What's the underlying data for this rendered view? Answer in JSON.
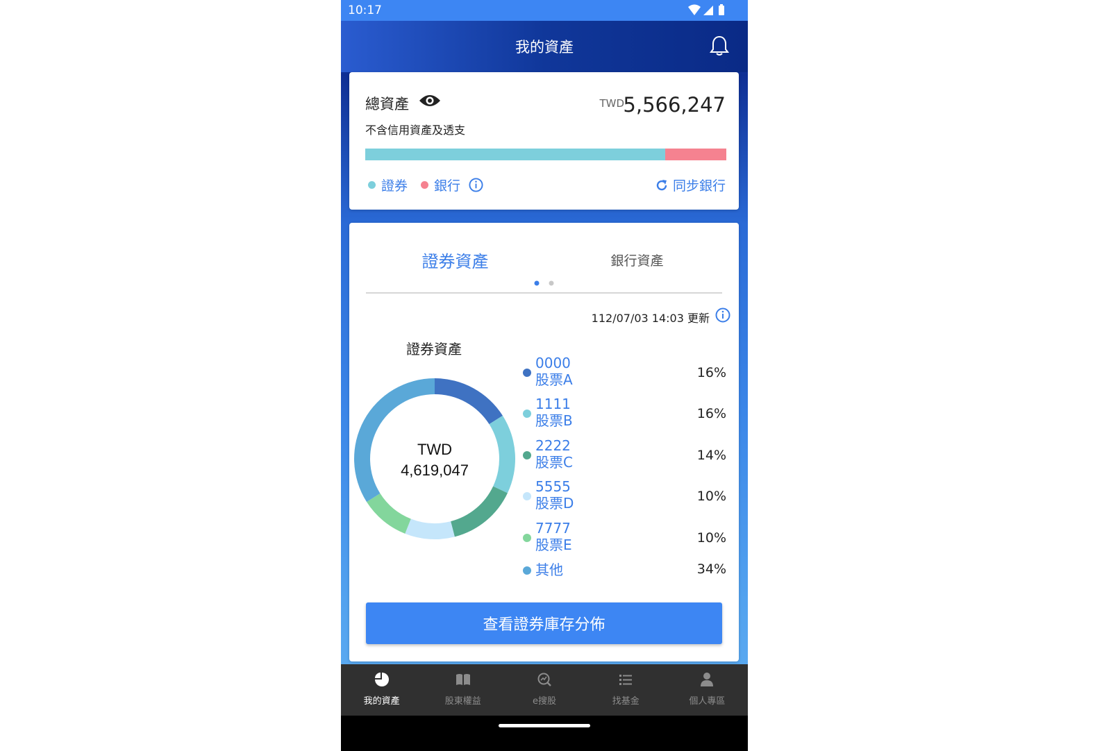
{
  "status_bar": {
    "time": "10:17"
  },
  "header": {
    "title": "我的資產"
  },
  "total_card": {
    "label": "總資產",
    "currency": "TWD",
    "amount": "5,566,247",
    "subtitle": "不含信用資產及透支",
    "ratio": {
      "securities": 0.83,
      "bank": 0.17
    },
    "legend": [
      {
        "label": "證券",
        "color": "#7dcfdc"
      },
      {
        "label": "銀行",
        "color": "#f58290"
      }
    ],
    "sync_label": "同步銀行"
  },
  "asset_card": {
    "tabs": [
      {
        "label": "證券資產",
        "active": true
      },
      {
        "label": "銀行資產",
        "active": false
      }
    ],
    "update_text": "112/07/03 14:03 更新",
    "chart_title": "證券資產",
    "center_currency": "TWD",
    "center_amount": "4,619,047",
    "button_label": "查看證券庫存分佈"
  },
  "chart_data": {
    "type": "pie",
    "title": "證券資產",
    "categories": [
      "0000 股票A",
      "1111 股票B",
      "2222 股票C",
      "5555 股票D",
      "7777 股票E",
      "其他"
    ],
    "values": [
      16,
      16,
      14,
      10,
      10,
      34
    ],
    "colors": [
      "#3f72c2",
      "#7dcfdc",
      "#53a88e",
      "#c5e6fb",
      "#83d69c",
      "#5aa8d8"
    ],
    "legend": [
      {
        "code": "0000",
        "name": "股票A",
        "pct": "16%"
      },
      {
        "code": "1111",
        "name": "股票B",
        "pct": "16%"
      },
      {
        "code": "2222",
        "name": "股票C",
        "pct": "14%"
      },
      {
        "code": "5555",
        "name": "股票D",
        "pct": "10%"
      },
      {
        "code": "7777",
        "name": "股票E",
        "pct": "10%"
      },
      {
        "code": "",
        "name": "其他",
        "pct": "34%"
      }
    ]
  },
  "bottom_nav": [
    {
      "label": "我的資產",
      "icon": "pie-chart-icon",
      "active": true
    },
    {
      "label": "股東權益",
      "icon": "book-icon",
      "active": false
    },
    {
      "label": "e搜股",
      "icon": "search-chart-icon",
      "active": false
    },
    {
      "label": "找基金",
      "icon": "list-icon",
      "active": false
    },
    {
      "label": "個人專區",
      "icon": "person-icon",
      "active": false
    }
  ]
}
